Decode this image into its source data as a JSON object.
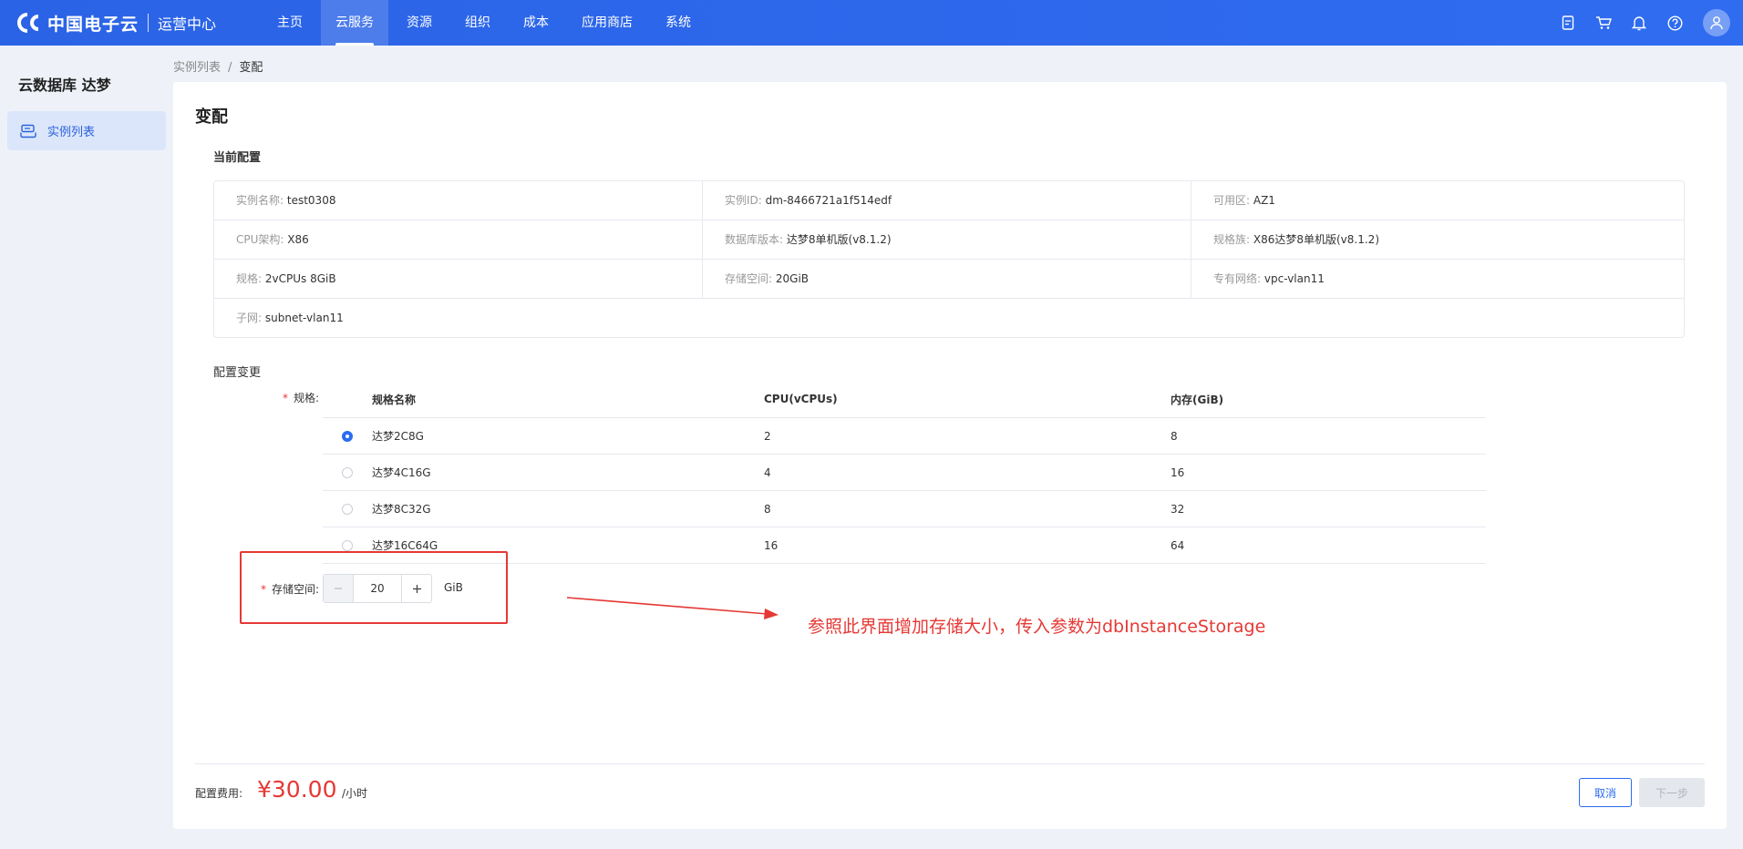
{
  "header": {
    "brand": "中国电子云",
    "subtitle": "运营中心",
    "nav": [
      {
        "label": "主页",
        "active": false
      },
      {
        "label": "云服务",
        "active": true
      },
      {
        "label": "资源",
        "active": false
      },
      {
        "label": "组织",
        "active": false
      },
      {
        "label": "成本",
        "active": false
      },
      {
        "label": "应用商店",
        "active": false
      },
      {
        "label": "系统",
        "active": false
      }
    ],
    "icons": [
      "document-icon",
      "cart-icon",
      "bell-icon",
      "help-icon",
      "user-avatar-icon"
    ]
  },
  "sidebar": {
    "title": "云数据库 达梦",
    "items": [
      {
        "label": "实例列表",
        "icon": "database-icon",
        "active": true
      }
    ]
  },
  "breadcrumb": {
    "items": [
      "实例列表",
      "变配"
    ],
    "separator": "/"
  },
  "page": {
    "title": "变配"
  },
  "current_config": {
    "title": "当前配置",
    "rows": [
      [
        {
          "label": "实例名称:",
          "value": "test0308"
        },
        {
          "label": "实例ID:",
          "value": "dm-8466721a1f514edf"
        },
        {
          "label": "可用区:",
          "value": "AZ1"
        }
      ],
      [
        {
          "label": "CPU架构:",
          "value": "X86"
        },
        {
          "label": "数据库版本:",
          "value": "达梦8单机版(v8.1.2)"
        },
        {
          "label": "规格族:",
          "value": "X86达梦8单机版(v8.1.2)"
        }
      ],
      [
        {
          "label": "规格:",
          "value": "2vCPUs 8GiB"
        },
        {
          "label": "存储空间:",
          "value": "20GiB"
        },
        {
          "label": "专有网络:",
          "value": "vpc-vlan11"
        }
      ],
      [
        {
          "label": "子网:",
          "value": "subnet-vlan11"
        }
      ]
    ]
  },
  "config_change": {
    "title": "配置变更",
    "spec_label": "规格:",
    "spec_columns": [
      "规格名称",
      "CPU(vCPUs)",
      "内存(GiB)"
    ],
    "spec_rows": [
      {
        "name": "达梦2C8G",
        "cpu": "2",
        "mem": "8",
        "selected": true
      },
      {
        "name": "达梦4C16G",
        "cpu": "4",
        "mem": "16",
        "selected": false
      },
      {
        "name": "达梦8C32G",
        "cpu": "8",
        "mem": "32",
        "selected": false
      },
      {
        "name": "达梦16C64G",
        "cpu": "16",
        "mem": "64",
        "selected": false
      }
    ],
    "storage_label": "存储空间:",
    "storage_value": "20",
    "storage_unit": "GiB",
    "required_mark": "*"
  },
  "annotation": {
    "text": "参照此界面增加存储大小，传入参数为dbInstanceStorage",
    "color": "#e53935"
  },
  "footer": {
    "price_label": "配置费用:",
    "price_value": "¥30.00",
    "price_unit": "/小时",
    "cancel_label": "取消",
    "next_label": "下一步"
  },
  "colors": {
    "primary": "#2b6cf0",
    "danger": "#e53935",
    "header_bg": "#2b63e6"
  }
}
